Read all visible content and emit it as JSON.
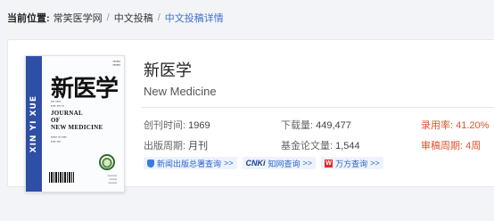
{
  "breadcrumb": {
    "prefix": "当前位置:",
    "items": [
      "常笑医学网",
      "中文投稿"
    ],
    "separator": "/",
    "current": "中文投稿详情"
  },
  "journal": {
    "name": "新医学",
    "name_en": "New Medicine",
    "stats": {
      "founded_label": "创刊时间:",
      "founded_value": "1969",
      "downloads_label": "下载量:",
      "downloads_value": "449,477",
      "acceptance_label": "录用率:",
      "acceptance_value": "41.20%",
      "cycle_label": "出版周期:",
      "cycle_value": "月刊",
      "fund_label": "基金论文量:",
      "fund_value": "1,544",
      "review_label": "审稿周期:",
      "review_value": "4周"
    },
    "links": [
      {
        "label": "新闻出版总署查询",
        "arrow": ">>",
        "icon": "shield-icon"
      },
      {
        "label": "知网查询",
        "arrow": ">>",
        "icon": "cnki-logo-icon",
        "logo_text": "CNKi"
      },
      {
        "label": "万方查询",
        "arrow": ">>",
        "icon": "wanfang-logo-icon",
        "logo_text": "W"
      }
    ]
  },
  "cover": {
    "spine_text": "XIN YI XUE",
    "title_cn": "新医学",
    "title_en_lines": [
      "JOURNAL",
      "OF",
      "NEW MEDICINE"
    ],
    "colors": {
      "spine": "#2f4ea6"
    }
  },
  "colors": {
    "accent_blue": "#3d6fd1",
    "highlight_red": "#e0542e"
  }
}
